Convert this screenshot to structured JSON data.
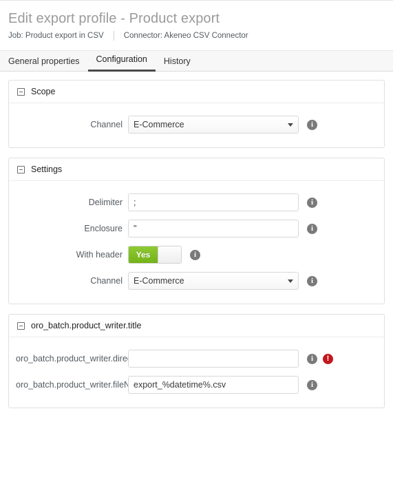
{
  "header": {
    "title": "Edit export profile - Product export",
    "job_label": "Job: Product export in CSV",
    "connector_label": "Connector: Akeneo CSV Connector"
  },
  "tabs": [
    {
      "label": "General properties",
      "active": false
    },
    {
      "label": "Configuration",
      "active": true
    },
    {
      "label": "History",
      "active": false
    }
  ],
  "sections": {
    "scope": {
      "title": "Scope",
      "collapse_icon": "minus-box-icon",
      "channel": {
        "label": "Channel",
        "value": "E-Commerce",
        "info_icon": "info-icon"
      }
    },
    "settings": {
      "title": "Settings",
      "collapse_icon": "minus-box-icon",
      "delimiter": {
        "label": "Delimiter",
        "value": ";",
        "info_icon": "info-icon"
      },
      "enclosure": {
        "label": "Enclosure",
        "value": "\"",
        "info_icon": "info-icon"
      },
      "with_header": {
        "label": "With header",
        "state": "Yes",
        "info_icon": "info-icon"
      },
      "channel": {
        "label": "Channel",
        "value": "E-Commerce",
        "info_icon": "info-icon"
      }
    },
    "writer": {
      "title": "oro_batch.product_writer.title",
      "collapse_icon": "minus-box-icon",
      "directory": {
        "label": "oro_batch.product_writer.directory",
        "value": "",
        "info_icon": "info-icon",
        "error_icon": "error-icon"
      },
      "filename": {
        "label": "oro_batch.product_writer.fileName",
        "value": "export_%datetime%.csv",
        "info_icon": "info-icon"
      }
    }
  },
  "glyphs": {
    "info": "i",
    "error": "!"
  },
  "colors": {
    "toggle_on": "#7db31c",
    "error": "#c3161c",
    "tab_active_underline": "#4a4a4a",
    "title": "#9a9a9a"
  }
}
